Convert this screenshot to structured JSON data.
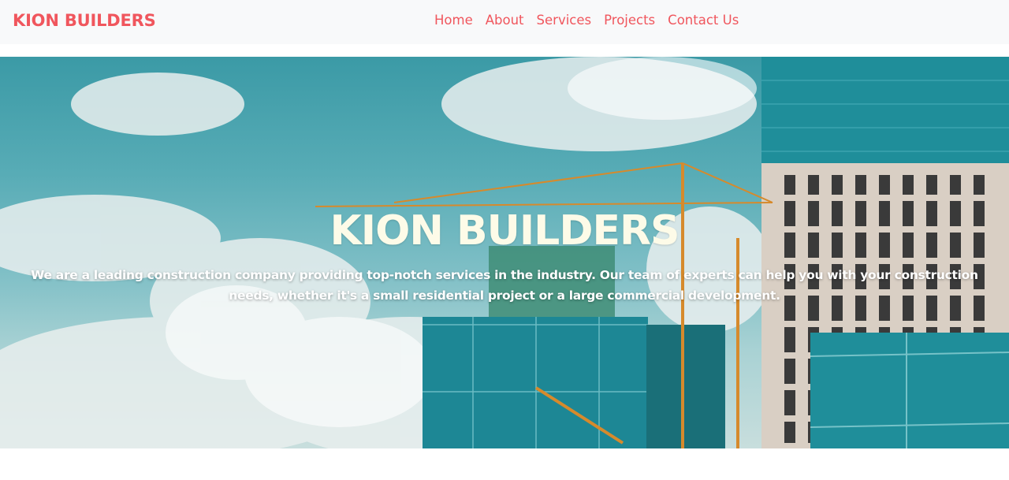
{
  "navbar": {
    "brand": "KION BUILDERS",
    "links": [
      {
        "label": "Home"
      },
      {
        "label": "About"
      },
      {
        "label": "Services"
      },
      {
        "label": "Projects"
      },
      {
        "label": "Contact Us"
      }
    ]
  },
  "hero": {
    "title": "KION BUILDERS",
    "description": "We are a leading construction company providing top-notch services in the industry. Our team of experts can help you with your construction needs, whether it's a small residential project or a large commercial development."
  },
  "colors": {
    "brand": "#f0565d",
    "navbar_bg": "#f8f9fa",
    "hero_title": "#fdfbe8",
    "hero_text": "#ffffff"
  }
}
